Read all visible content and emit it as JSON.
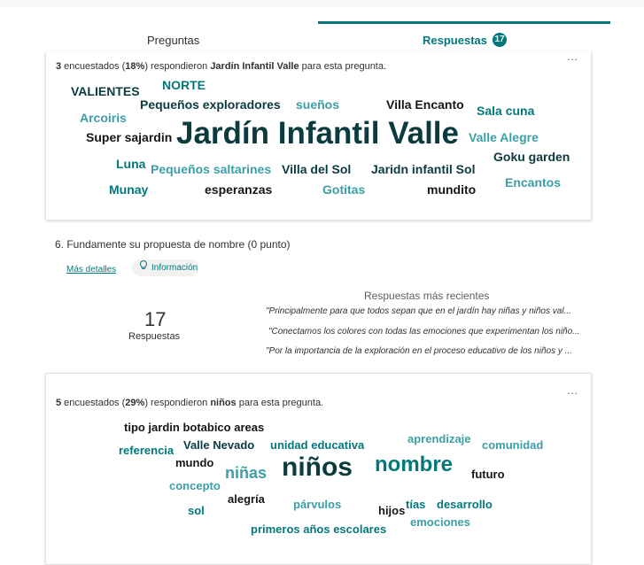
{
  "tabs": {
    "questions_label": "Preguntas",
    "responses_label": "Respuestas",
    "responses_count": "17"
  },
  "card1": {
    "more": "...",
    "summary": {
      "count": "3",
      "pre": " encuestados (",
      "pct": "18%",
      "mid": ") respondieron ",
      "keyword": "Jardín Infantil Valle",
      "post": " para esta pregunta."
    },
    "words": [
      "VALIENTES",
      "NORTE",
      "Pequeños exploradores",
      "sueños",
      "Villa Encanto",
      "Arcoiris",
      "Sala cuna",
      "Super sajardin",
      "Jardín Infantil Valle",
      "Valle Alegre",
      "Luna",
      "Pequeños saltarines",
      "Villa del Sol",
      "Jaridn infantil Sol",
      "Goku garden",
      "Munay",
      "esperanzas",
      "Gotitas",
      "mundito",
      "Encantos"
    ]
  },
  "question": {
    "title": "6.  Fundamente su propuesta de nombre (0 punto)",
    "details_link": "Más detalles",
    "info_label": "Información",
    "count": "17",
    "count_label": "Respuestas",
    "recent_title": "Respuestas más recientes",
    "recent": [
      "\"Principalmente para que todos sepan que en el jardín hay niñas y niños val...",
      "\"Conectamos los colores con todas las emociones que experimentan los niño...",
      "\"Por la importancia de la exploración en el proceso educativo de los niños y ..."
    ]
  },
  "card2": {
    "more": "...",
    "summary": {
      "count": "5",
      "pre": " encuestados (",
      "pct": "29%",
      "mid": ") respondieron ",
      "keyword": "niños",
      "post": " para esta pregunta."
    },
    "words": [
      "tipo jardin botabico areas",
      "referencia",
      "Valle Nevado",
      "unidad educativa",
      "aprendizaje",
      "comunidad",
      "mundo",
      "niñas",
      "niños",
      "nombre",
      "futuro",
      "concepto",
      "alegría",
      "sol",
      "párvulos",
      "hijos",
      "tías",
      "desarrollo",
      "emociones",
      "primeros años escolares"
    ]
  },
  "colors": {
    "accent": "#03787c",
    "word_dark": "#0b3b3e",
    "word_black": "#161616",
    "word_teal": "#03787c",
    "word_light": "#3c9ea6"
  },
  "icons": {
    "info": "lightbulb-icon"
  }
}
